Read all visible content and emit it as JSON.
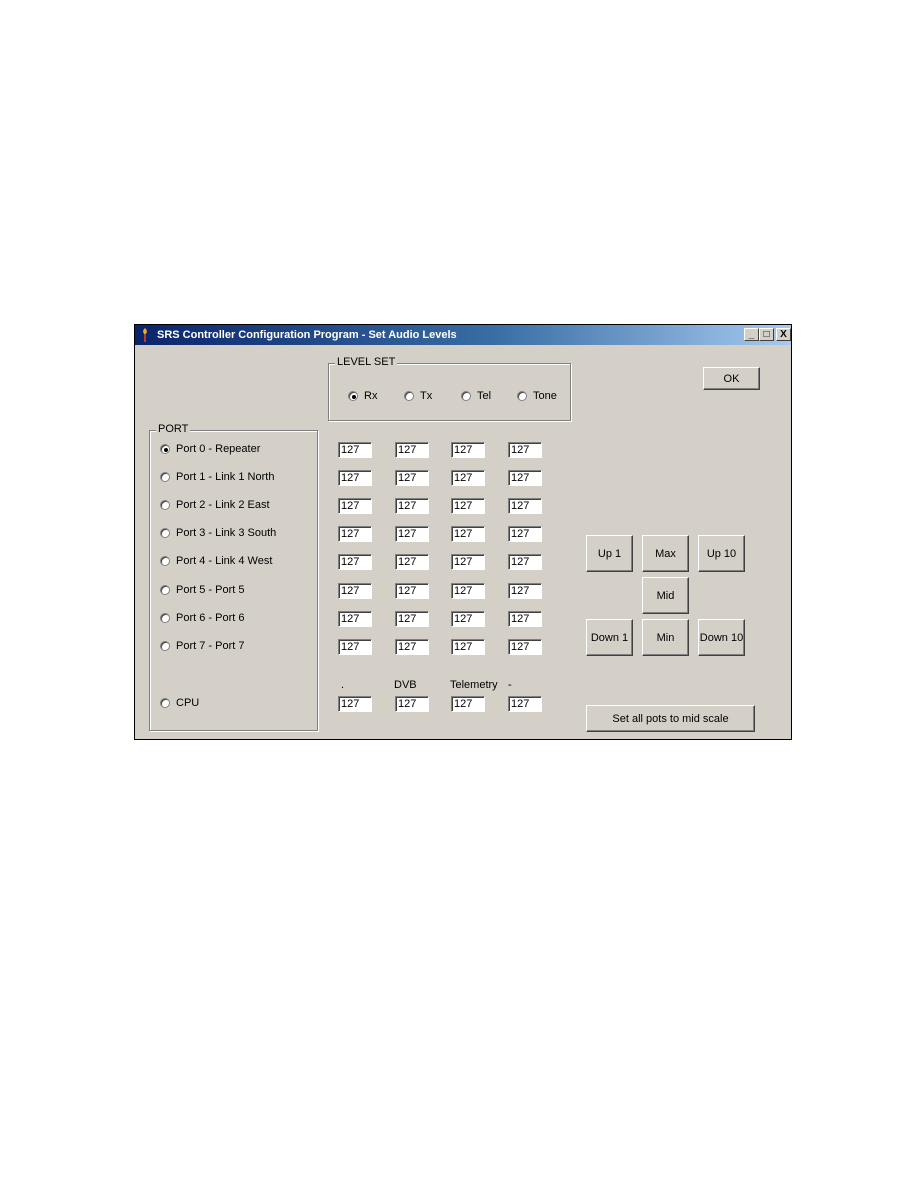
{
  "window": {
    "title": "SRS Controller Configuration Program - Set Audio Levels",
    "controls": {
      "minimize": "_",
      "maximize": "□",
      "close": "X"
    }
  },
  "level_set": {
    "label": "LEVEL SET",
    "options": [
      {
        "label": "Rx",
        "checked": true
      },
      {
        "label": "Tx",
        "checked": false
      },
      {
        "label": "Tel",
        "checked": false
      },
      {
        "label": "Tone",
        "checked": false
      }
    ]
  },
  "port": {
    "label": "PORT",
    "options": [
      {
        "label": "Port 0 - Repeater",
        "checked": true
      },
      {
        "label": "Port 1 - Link 1 North",
        "checked": false
      },
      {
        "label": "Port 2 - Link 2 East",
        "checked": false
      },
      {
        "label": "Port 3 - Link 3 South",
        "checked": false
      },
      {
        "label": "Port 4 - Link 4 West",
        "checked": false
      },
      {
        "label": "Port 5 - Port 5",
        "checked": false
      },
      {
        "label": "Port 6 - Port 6",
        "checked": false
      },
      {
        "label": "Port 7 - Port 7",
        "checked": false
      },
      {
        "label": "CPU",
        "checked": false
      }
    ]
  },
  "levels": {
    "rows": [
      [
        "127",
        "127",
        "127",
        "127"
      ],
      [
        "127",
        "127",
        "127",
        "127"
      ],
      [
        "127",
        "127",
        "127",
        "127"
      ],
      [
        "127",
        "127",
        "127",
        "127"
      ],
      [
        "127",
        "127",
        "127",
        "127"
      ],
      [
        "127",
        "127",
        "127",
        "127"
      ],
      [
        "127",
        "127",
        "127",
        "127"
      ],
      [
        "127",
        "127",
        "127",
        "127"
      ]
    ],
    "cpu_labels": [
      ".",
      "DVB",
      "Telemetry",
      "-"
    ],
    "cpu_values": [
      "127",
      "127",
      "127",
      "127"
    ]
  },
  "buttons": {
    "ok": "OK",
    "up1": "Up 1",
    "max": "Max",
    "up10": "Up 10",
    "mid": "Mid",
    "down1": "Down 1",
    "min": "Min",
    "down10": "Down 10",
    "set_mid": "Set all pots to mid scale"
  }
}
